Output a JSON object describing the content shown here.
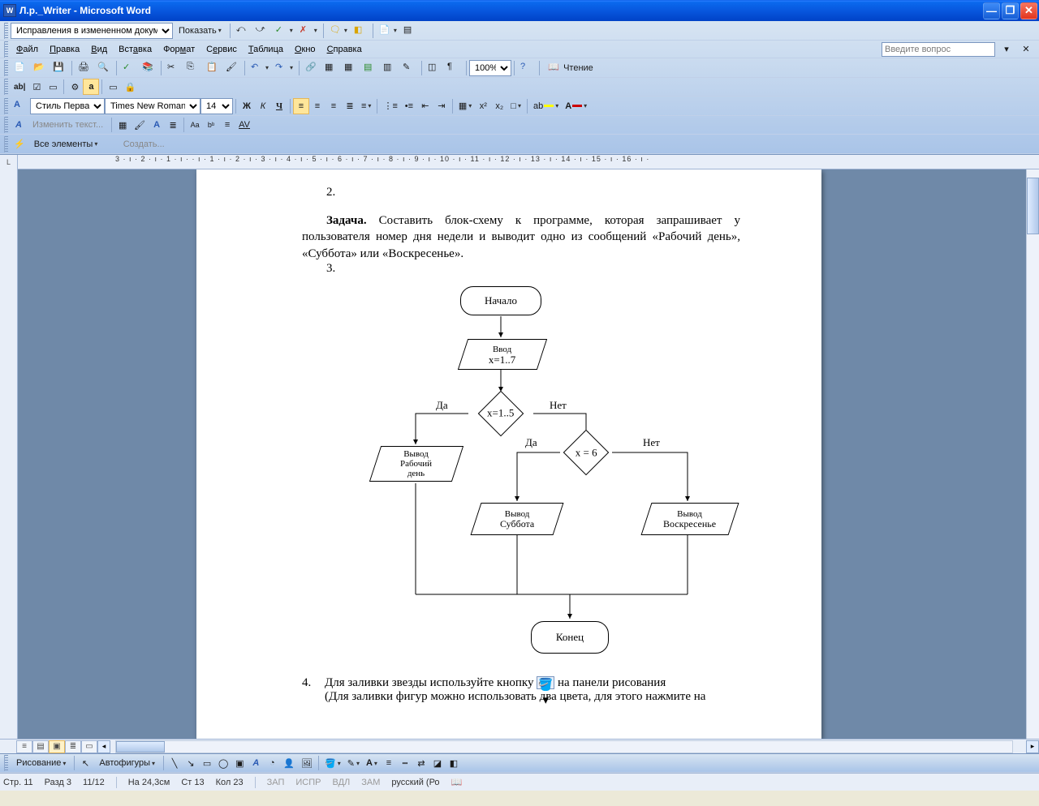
{
  "title": "Л.р._Writer - Microsoft Word",
  "menu": {
    "file": "Файл",
    "edit": "Правка",
    "view": "Вид",
    "insert": "Вставка",
    "format": "Формат",
    "service": "Сервис",
    "table": "Таблица",
    "window": "Окно",
    "help": "Справка"
  },
  "help_placeholder": "Введите вопрос",
  "toolbar": {
    "track_label": "Исправления в измененном документе",
    "show_label": "Показать",
    "zoom": "100%",
    "reading": "Чтение",
    "style_label": "Стиль Первая с",
    "font_name": "Times New Roman",
    "font_size": "14",
    "all_elements": "Все элементы",
    "create": "Создать...",
    "change_text": "Изменить текст...",
    "drawing": "Рисование",
    "autoshapes": "Автофигуры"
  },
  "ruler_marks": "3 · ı · 2 · ı · 1 · ı ·        · ı · 1 · ı · 2 · ı · 3 · ı · 4 · ı · 5 · ı · 6 · ı · 7 · ı · 8 · ı · 9 · ı · 10 · ı · 11 · ı · 12 · ı · 13 · ı · 14 · ı · 15 · ı · 16 · ı ·",
  "doc": {
    "num2": "2.",
    "task_label": "Задача.",
    "task_text": " Составить блок-схему к программе, которая запрашивает у пользователя номер дня недели и выводит одно из сообщений «Рабочий день», «Суббота» или «Воскресенье».",
    "num3": "3.",
    "num4": "4.",
    "fill_text_1": "Для заливки звезды используйте кнопку ",
    "fill_text_2": " на панели рисования",
    "fill_text_3": "(Для заливки фигур можно использовать два цвета, для этого нажмите на"
  },
  "flowchart": {
    "start": "Начало",
    "input1": "Ввод",
    "input2": "x=1..7",
    "cond1": "x=1..5",
    "cond2": "x = 6",
    "yes": "Да",
    "no": "Нет",
    "out1a": "Вывод",
    "out1b": "Рабочий",
    "out1c": "день",
    "out2a": "Вывод",
    "out2b": "Суббота",
    "out3a": "Вывод",
    "out3b": "Воскресенье",
    "end": "Конец"
  },
  "status": {
    "page": "Стр. 11",
    "section": "Разд 3",
    "pages": "11/12",
    "at": "На 24,3см",
    "line": "Ст 13",
    "col": "Кол 23",
    "rec": "ЗАП",
    "fix": "ИСПР",
    "ext": "ВДЛ",
    "ovr": "ЗАМ",
    "lang": "русский (Ро"
  }
}
